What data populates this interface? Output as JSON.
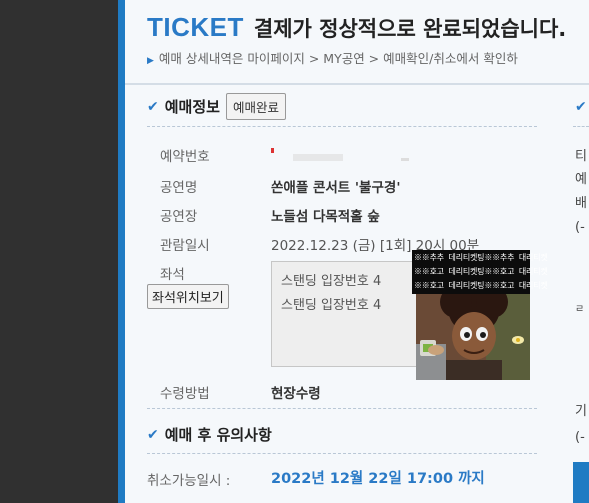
{
  "header": {
    "ticket_word": "TICKET",
    "message": "결제가 정상적으로 완료되었습니다.",
    "subline": "예매 상세내역은 마이페이지 > MY공연 > 예매확인/취소에서 확인하"
  },
  "booking_info": {
    "title": "예매정보",
    "status_button": "예매완료",
    "rows": {
      "reservation_no": {
        "label": "예약번호"
      },
      "performance": {
        "label": "공연명",
        "value": "쏜애플 콘서트 '불구경'"
      },
      "venue": {
        "label": "공연장",
        "value": "노들섬 다목적홀 숲"
      },
      "date": {
        "label": "관람일시",
        "value": "2022.12.23 (금) [1회] 20시 00분"
      },
      "seat": {
        "label": "좌석",
        "view_button": "좌석위치보기",
        "lines": [
          "스탠딩 입장번호 4",
          "스탠딩 입장번호 4"
        ]
      },
      "delivery": {
        "label": "수령방법",
        "value": "현장수령"
      }
    }
  },
  "notice": {
    "title": "예매 후 유의사항",
    "cancel_label": "취소가능일시 :",
    "cancel_date": "2022년 12월 22일 17:00 까지"
  },
  "right_column": {
    "chars": [
      "티",
      "예",
      "배",
      "(-",
      "기",
      "(-"
    ],
    "mark": "ㄹ"
  },
  "overlay": {
    "lines": [
      "※※추추 데리티켓팅※※추추 대리티켓",
      "※※호고 데리티켓팅※※호고 대리티켓",
      "※※호고 데리티켓팅※※호고 대리티켓"
    ]
  },
  "colors": {
    "accent_blue": "#2a7ac6",
    "side_bar": "#1f7bc3",
    "background_dark": "#303030"
  }
}
